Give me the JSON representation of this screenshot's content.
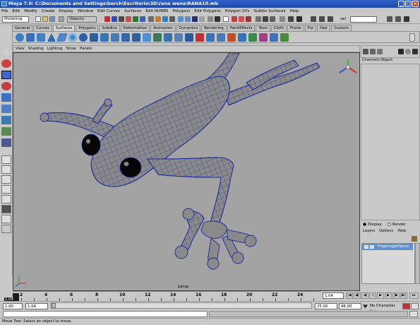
{
  "window": {
    "title": "Maya 7.0: C:\\Documents and Settings\\borch\\Escritorio\\3D\\rana wena\\RANA10.mb"
  },
  "menubar": {
    "items": [
      "File",
      "Edit",
      "Modify",
      "Create",
      "Display",
      "Window",
      "Edit Curves",
      "Surfaces",
      "Edit NURBS",
      "Polygons",
      "Edit Polygons",
      "Polygon UVs",
      "Subdiv Surfaces",
      "Help"
    ]
  },
  "statusline": {
    "mode_select": "Modeling",
    "objects_label": "Objects",
    "sel_label": "sel"
  },
  "shelf": {
    "tabs": [
      "General",
      "Curves",
      "Surfaces",
      "Polygons",
      "Subdivs",
      "Deformation",
      "Animation",
      "Dynamics",
      "Rendering",
      "PaintEffects",
      "Toon",
      "Cloth",
      "Fluids",
      "Fur",
      "Hair",
      "Custom"
    ],
    "active_tab": "Surfaces"
  },
  "viewport": {
    "menus": [
      "View",
      "Shading",
      "Lighting",
      "Show",
      "Panels"
    ],
    "camera_label": "persp",
    "background_color": "#a3a3a3",
    "wire_color": "#1a2a9a"
  },
  "channel_box": {
    "tabs": [
      "Channels",
      "Object"
    ]
  },
  "layer_editor": {
    "display_option": "Display",
    "render_option": "Render",
    "menus": [
      "Layers",
      "Options",
      "Help"
    ],
    "layers": [
      {
        "name": "FrogImagePlanes"
      }
    ]
  },
  "time_slider": {
    "tick_labels": [
      "2",
      "4",
      "6",
      "8",
      "10",
      "12",
      "14",
      "16",
      "18",
      "20",
      "22",
      "24"
    ],
    "current_frame_field": "1.04",
    "current_frame_marker": "1.04"
  },
  "range_slider": {
    "start_time": "1.00",
    "range_start": "1.04",
    "range_end": "25.00",
    "end_time": "48.00",
    "character_set": "No Character Set"
  },
  "help_line": {
    "text": "Move Tool: Select an object to move."
  }
}
